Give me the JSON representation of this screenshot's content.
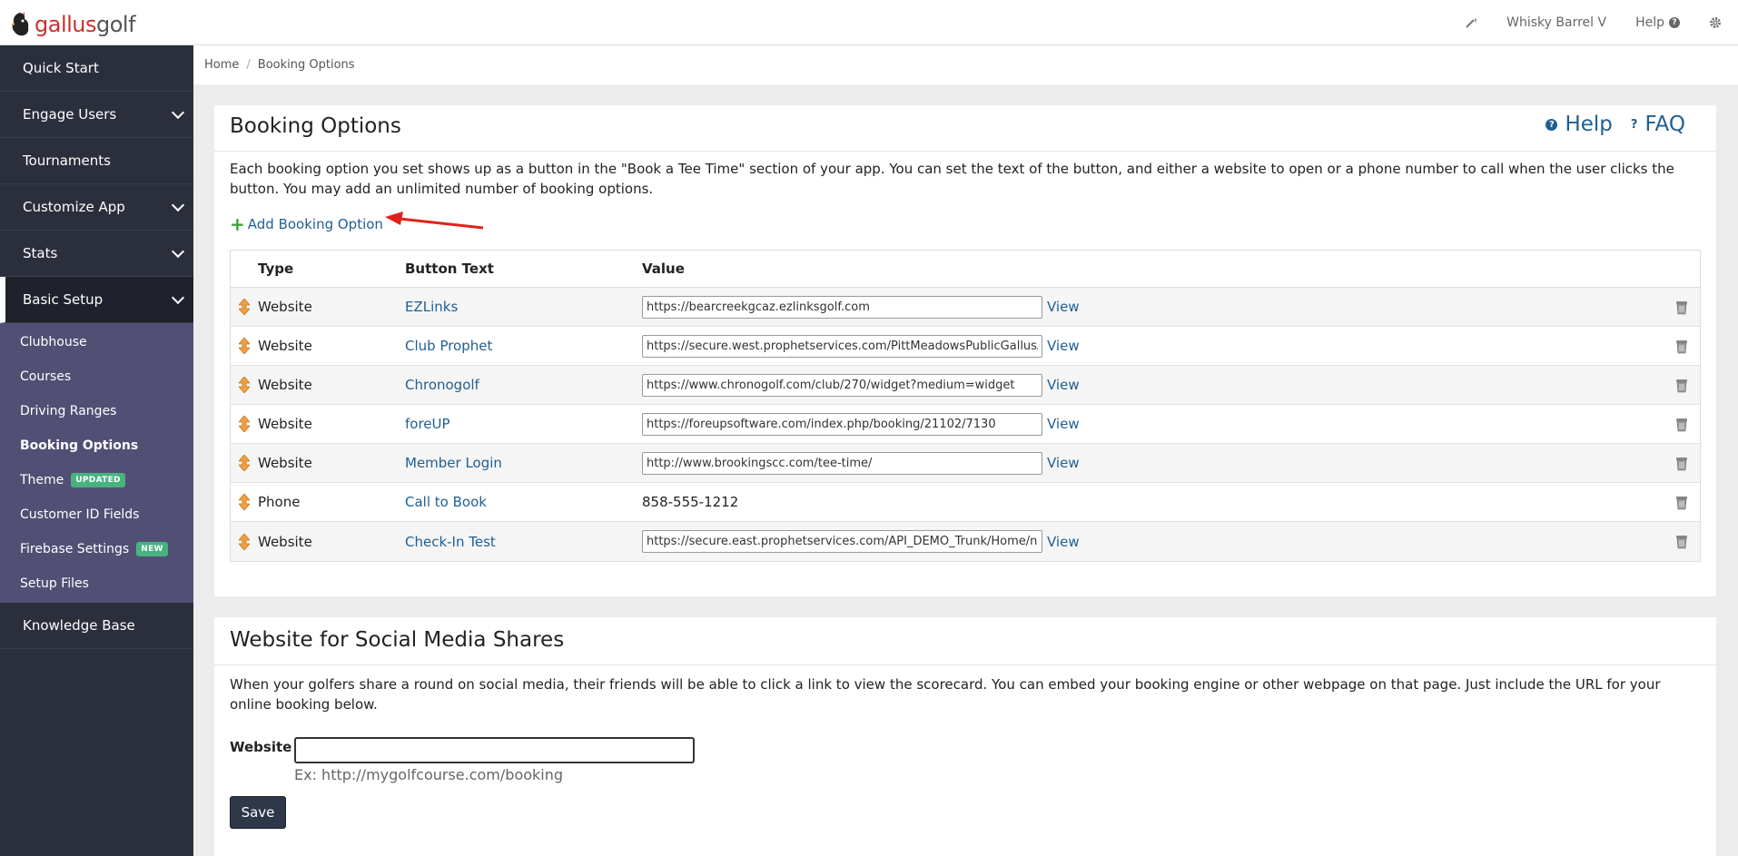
{
  "header": {
    "logo_part1": "gallus",
    "logo_part2": "golf",
    "course_name": "Whisky Barrel V",
    "help_label": "Help"
  },
  "sidebar": {
    "items": [
      {
        "label": "Quick Start"
      },
      {
        "label": "Engage Users"
      },
      {
        "label": "Tournaments"
      },
      {
        "label": "Customize App"
      },
      {
        "label": "Stats"
      },
      {
        "label": "Basic Setup"
      },
      {
        "label": "Knowledge Base"
      }
    ],
    "sub_items": [
      {
        "label": "Clubhouse"
      },
      {
        "label": "Courses"
      },
      {
        "label": "Driving Ranges"
      },
      {
        "label": "Booking Options"
      },
      {
        "label": "Theme",
        "badge": "UPDATED"
      },
      {
        "label": "Customer ID Fields"
      },
      {
        "label": "Firebase Settings",
        "badge": "NEW"
      },
      {
        "label": "Setup Files"
      }
    ]
  },
  "breadcrumb": {
    "home": "Home",
    "sep": "/",
    "current": "Booking Options"
  },
  "booking_panel": {
    "title": "Booking Options",
    "help": "Help",
    "faq": "FAQ",
    "description": "Each booking option you set shows up as a button in the \"Book a Tee Time\" section of your app. You can set the text of the button, and either a website to open or a phone number to call when the user clicks the button. You may add an unlimited number of booking options.",
    "add_label": "Add Booking Option",
    "columns": {
      "type": "Type",
      "button_text": "Button Text",
      "value": "Value"
    },
    "view_label": "View",
    "rows": [
      {
        "type": "Website",
        "text": "EZLinks",
        "value": "https://bearcreekgcaz.ezlinksgolf.com"
      },
      {
        "type": "Website",
        "text": "Club Prophet",
        "value": "https://secure.west.prophetservices.com/PittMeadowsPublicGallusApp"
      },
      {
        "type": "Website",
        "text": "Chronogolf",
        "value": "https://www.chronogolf.com/club/270/widget?medium=widget"
      },
      {
        "type": "Website",
        "text": "foreUP",
        "value": "https://foreupsoftware.com/index.php/booking/21102/7130"
      },
      {
        "type": "Website",
        "text": "Member Login",
        "value": "http://www.brookingscc.com/tee-time/"
      },
      {
        "type": "Phone",
        "text": "Call to Book",
        "value": "858-555-1212"
      },
      {
        "type": "Website",
        "text": "Check-In Test",
        "value": "https://secure.east.prophetservices.com/API_DEMO_Trunk/Home/nIndex"
      }
    ]
  },
  "social_panel": {
    "title": "Website for Social Media Shares",
    "description": "When your golfers share a round on social media, their friends will be able to click a link to view the scorecard. You can embed your booking engine or other webpage on that page. Just include the URL for your online booking below.",
    "website_label": "Website",
    "website_value": "",
    "hint": "Ex: http://mygolfcourse.com/booking",
    "save_label": "Save"
  }
}
